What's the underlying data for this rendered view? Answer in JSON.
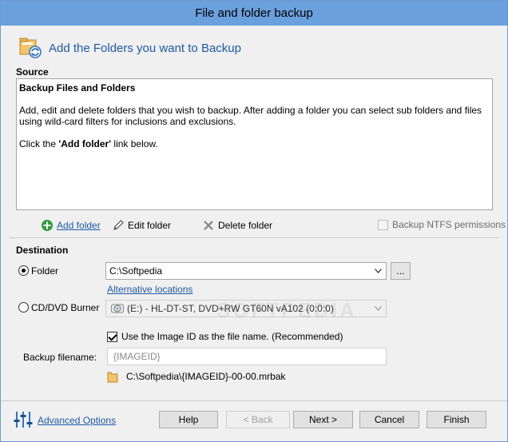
{
  "window": {
    "title": "File and folder backup"
  },
  "header": {
    "title": "Add the Folders you want to Backup",
    "icon": "folder-backup-icon"
  },
  "source": {
    "label": "Source",
    "heading": "Backup Files and Folders",
    "paragraph": "Add, edit and delete folders that you wish to backup. After adding a folder you can select sub folders and files using wild-card filters for inclusions and exclusions.",
    "instruction_prefix": "Click the ",
    "instruction_bold": "'Add folder'",
    "instruction_suffix": " link below."
  },
  "actions": {
    "add_folder": "Add folder",
    "edit_folder": "Edit folder",
    "delete_folder": "Delete folder",
    "ntfs_permissions": "Backup NTFS permissions"
  },
  "destination": {
    "label": "Destination",
    "folder_option": "Folder",
    "folder_path": "C:\\Softpedia",
    "browse_label": "...",
    "alternative_locations": "Alternative locations",
    "cd_option": "CD/DVD Burner",
    "drive_value": "(E:) - HL-DT-ST, DVD+RW GT60N    vA102 (0:0:0)",
    "use_image_id": "Use the Image ID as the file name.  (Recommended)",
    "filename_label": "Backup filename:",
    "filename_value": "{IMAGEID}",
    "full_path": "C:\\Softpedia\\{IMAGEID}-00-00.mrbak"
  },
  "footer": {
    "advanced_options": "Advanced Options",
    "help": "Help",
    "back": "< Back",
    "next": "Next >",
    "cancel": "Cancel",
    "finish": "Finish"
  },
  "watermark": "SOFTPEDIA",
  "colors": {
    "titlebar": "#6aa0dc",
    "accent": "#1c5aa6",
    "add_icon": "#2e9e3e"
  }
}
